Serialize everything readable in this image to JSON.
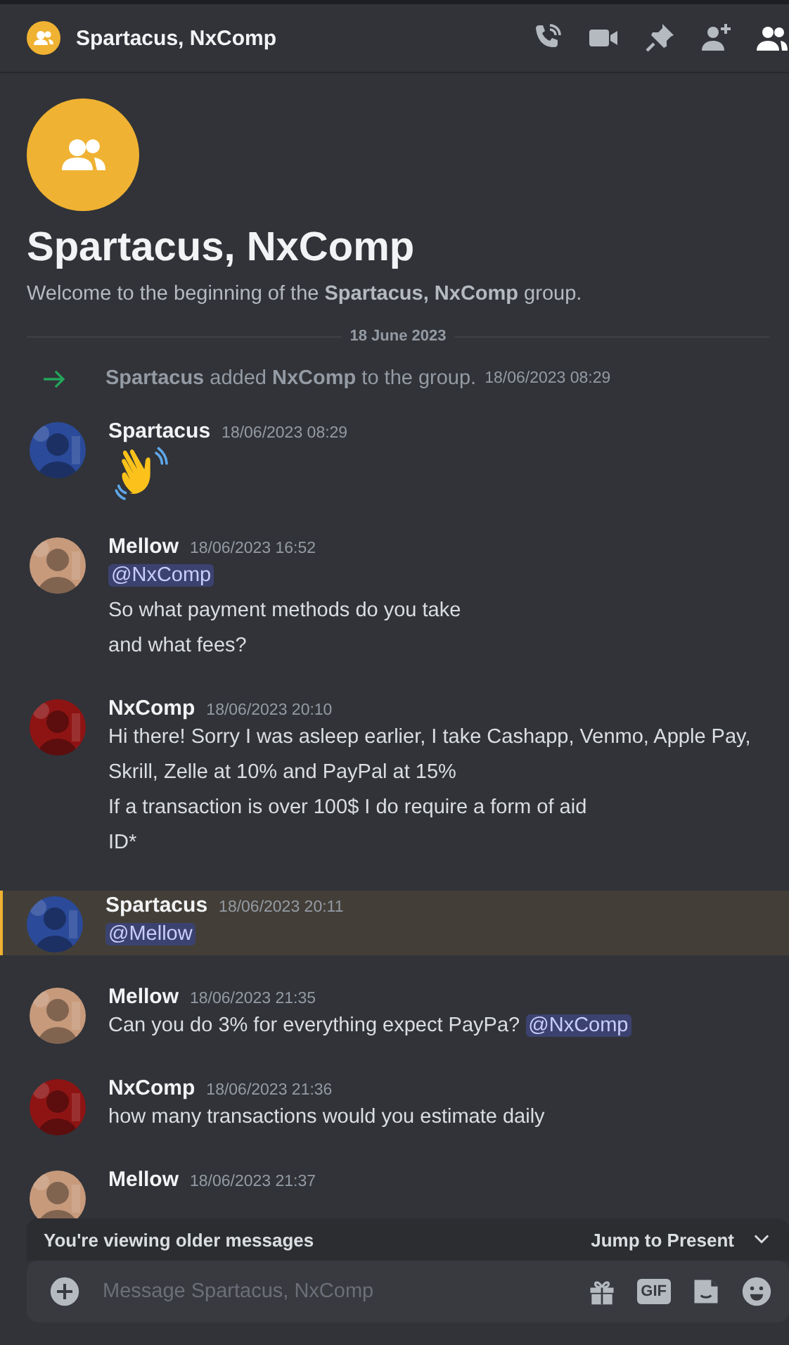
{
  "header": {
    "title": "Spartacus, NxComp"
  },
  "intro": {
    "title": "Spartacus, NxComp",
    "text": "Welcome to the beginning of the **Spartacus, NxComp** group."
  },
  "date_divider": "18 June 2023",
  "messages": [
    {
      "kind": "system",
      "text": "**Spartacus** added **NxComp** to the group.",
      "time": "18/06/2023 08:29"
    },
    {
      "kind": "user",
      "author": "Spartacus",
      "time": "18/06/2023 08:29",
      "highlighted": false,
      "avatar": {
        "kind": "picture",
        "color": "#2b4a9a"
      },
      "lines": [
        [
          {
            "kind": "wave"
          }
        ]
      ]
    },
    {
      "kind": "user",
      "author": "Mellow",
      "time": "18/06/2023 16:52",
      "highlighted": false,
      "avatar": {
        "kind": "picture",
        "color": "#c79a7c"
      },
      "lines": [
        [
          {
            "kind": "mention",
            "text": "@NxComp"
          }
        ],
        [
          {
            "kind": "text",
            "text": "So what payment methods do you take"
          }
        ],
        [
          {
            "kind": "text",
            "text": "and what fees?"
          }
        ]
      ]
    },
    {
      "kind": "user",
      "author": "NxComp",
      "time": "18/06/2023 20:10",
      "highlighted": false,
      "avatar": {
        "kind": "picture",
        "color": "#8e1414"
      },
      "lines": [
        [
          {
            "kind": "text",
            "text": "Hi there! Sorry I was asleep earlier, I take Cashapp, Venmo, Apple Pay, Skrill, Zelle at 10% and PayPal at 15%"
          }
        ],
        [
          {
            "kind": "text",
            "text": "If a transaction is over 100$ I do require a form of aid"
          }
        ],
        [
          {
            "kind": "text",
            "text": "ID*"
          }
        ]
      ]
    },
    {
      "kind": "user",
      "author": "Spartacus",
      "time": "18/06/2023 20:11",
      "highlighted": true,
      "avatar": {
        "kind": "picture",
        "color": "#2b4a9a"
      },
      "lines": [
        [
          {
            "kind": "mention",
            "text": "@Mellow"
          }
        ]
      ]
    },
    {
      "kind": "user",
      "author": "Mellow",
      "time": "18/06/2023 21:35",
      "highlighted": false,
      "avatar": {
        "kind": "picture",
        "color": "#c79a7c"
      },
      "lines": [
        [
          {
            "kind": "text",
            "text": "Can you do 3% for everything expect PayPa? "
          },
          {
            "kind": "mention",
            "text": "@NxComp"
          }
        ]
      ]
    },
    {
      "kind": "user",
      "author": "NxComp",
      "time": "18/06/2023 21:36",
      "highlighted": false,
      "avatar": {
        "kind": "picture",
        "color": "#8e1414"
      },
      "lines": [
        [
          {
            "kind": "text",
            "text": "how many transactions would you estimate daily"
          }
        ]
      ]
    },
    {
      "kind": "user",
      "author": "Mellow",
      "time": "18/06/2023 21:37",
      "highlighted": false,
      "avatar": {
        "kind": "picture",
        "color": "#c79a7c"
      }
    }
  ],
  "banner": {
    "text": "You're viewing older messages",
    "action": "Jump to Present"
  },
  "composer": {
    "placeholder": "Message Spartacus, NxComp",
    "gif_label": "GIF"
  }
}
